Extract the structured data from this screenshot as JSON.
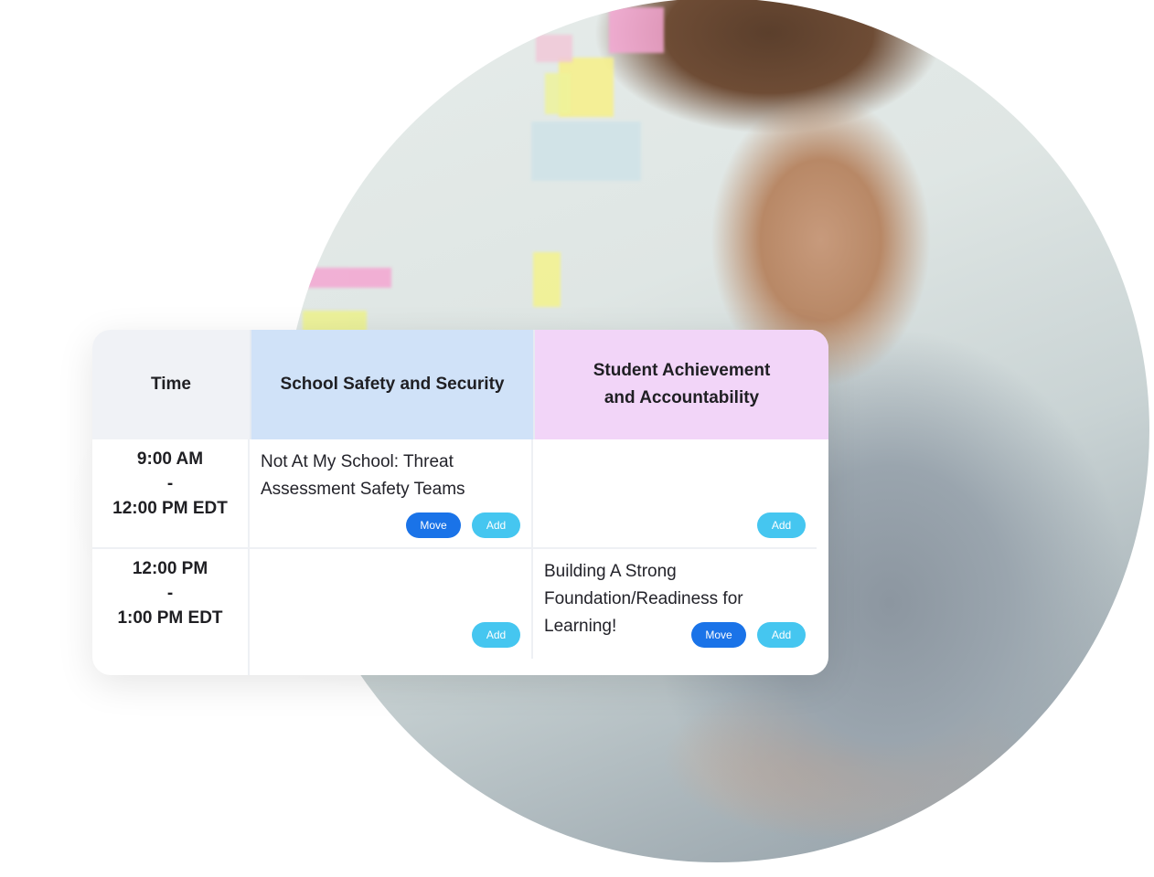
{
  "background": {
    "photo_description": "smiling man in checked shirt using a tablet, sticky notes on wall behind"
  },
  "schedule": {
    "headers": {
      "time": "Time",
      "tracks": [
        {
          "label": "School Safety and Security",
          "color": "#d0e2f8"
        },
        {
          "label": "Student Achievement and Accountability",
          "color": "#f2d5f8"
        }
      ]
    },
    "rows": [
      {
        "time_start": "9:00 AM",
        "separator": "-",
        "time_end": "12:00 PM EDT",
        "sessions": [
          {
            "title": "Not At My School: Threat Assessment Safety Teams",
            "move_label": "Move",
            "add_label": "Add"
          },
          {
            "title": "",
            "add_label": "Add"
          }
        ]
      },
      {
        "time_start": "12:00 PM",
        "separator": "-",
        "time_end": "1:00 PM EDT",
        "sessions": [
          {
            "title": "",
            "add_label": "Add"
          },
          {
            "title": "Building A Strong Foundation/Readiness for Learning!",
            "move_label": "Move",
            "add_label": "Add"
          }
        ]
      }
    ],
    "colors": {
      "move_button": "#1a73e8",
      "add_button": "#45c6f0"
    }
  }
}
